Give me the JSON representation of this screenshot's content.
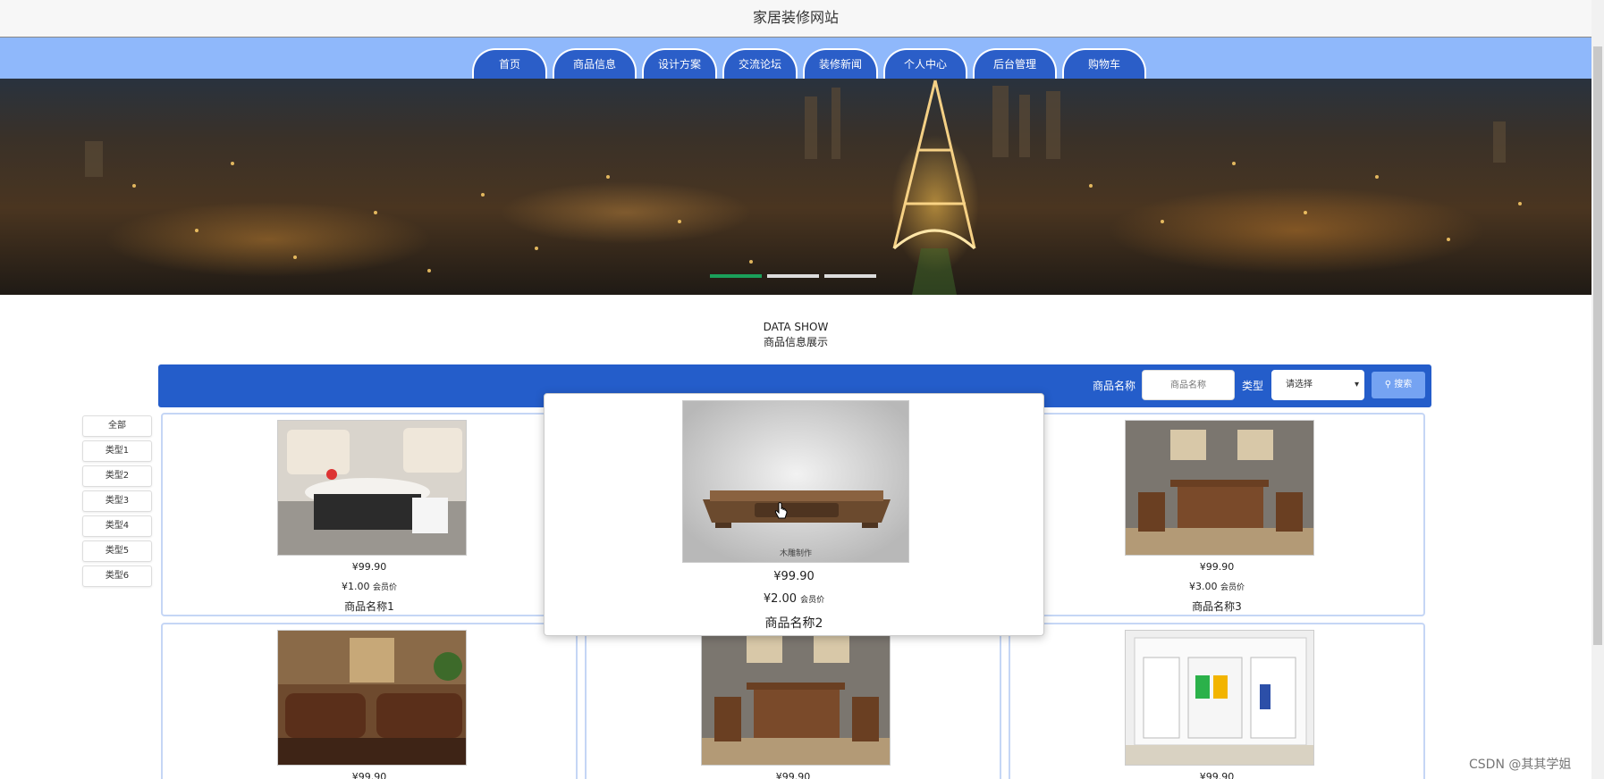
{
  "site_title": "家居装修网站",
  "nav": [
    "首页",
    "商品信息",
    "设计方案",
    "交流论坛",
    "装修新闻",
    "个人中心",
    "后台管理",
    "购物车"
  ],
  "section": {
    "en": "DATA SHOW",
    "cn": "商品信息展示"
  },
  "search": {
    "name_label": "商品名称",
    "name_placeholder": "商品名称",
    "type_label": "类型",
    "type_selected": "请选择",
    "button_label": "搜索"
  },
  "categories": [
    "全部",
    "类型1",
    "类型2",
    "类型3",
    "类型4",
    "类型5",
    "类型6"
  ],
  "products": [
    {
      "price": "¥99.90",
      "vip_price": "¥1.00",
      "vip_label": "会员价",
      "name": "商品名称1"
    },
    {
      "price": "¥99.90",
      "vip_price": "¥2.00",
      "vip_label": "会员价",
      "name": "商品名称2"
    },
    {
      "price": "¥99.90",
      "vip_price": "¥3.00",
      "vip_label": "会员价",
      "name": "商品名称3"
    },
    {
      "price": "¥99.90"
    },
    {
      "price": "¥99.90"
    },
    {
      "price": "¥99.90"
    }
  ],
  "product2_image_caption": "木雕制作",
  "banner_active_slide": 1,
  "banner_slide_count": 3,
  "watermark": "CSDN @其其学姐",
  "colors": {
    "nav_bar": "#8fb8fb",
    "nav_tab": "#2b5ec8",
    "search_bar": "#245dca",
    "active_dot": "#1aa05a"
  }
}
